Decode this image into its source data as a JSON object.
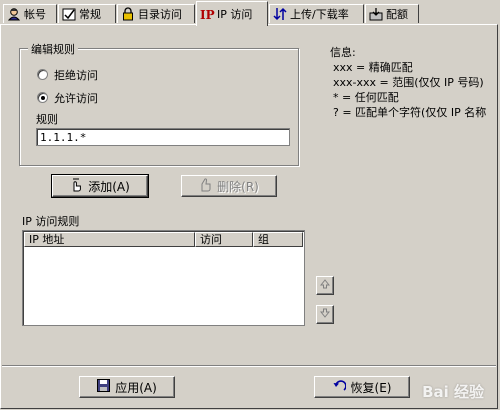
{
  "tabs": [
    {
      "label": "帐号",
      "icon": "user-icon"
    },
    {
      "label": "常规",
      "icon": "checklist-icon"
    },
    {
      "label": "目录访问",
      "icon": "lock-icon"
    },
    {
      "label": "IP 访问",
      "icon": "ip-icon"
    },
    {
      "label": "上传/下载率",
      "icon": "transfer-icon"
    },
    {
      "label": "配额",
      "icon": "quota-icon"
    }
  ],
  "edit_rule": {
    "title": "编辑规则",
    "deny_label": "拒绝访问",
    "allow_label": "允许访问",
    "selected": "allow",
    "rule_label": "规则",
    "rule_value": "1.1.1.*"
  },
  "buttons": {
    "add": "添加(A)",
    "delete": "删除(R)",
    "apply": "应用(A)",
    "restore": "恢复(E)"
  },
  "ip_rules": {
    "title": "IP 访问规则",
    "columns": [
      "IP 地址",
      "访问",
      "组"
    ],
    "rows": []
  },
  "info": {
    "title": "信息:",
    "lines": [
      "xxx = 精确匹配",
      "xxx-xxx = 范围(仅仅 IP 号码)",
      "* = 任何匹配",
      "? = 匹配单个字符(仅仅 IP 名称"
    ]
  },
  "watermark": "Bai 经验"
}
